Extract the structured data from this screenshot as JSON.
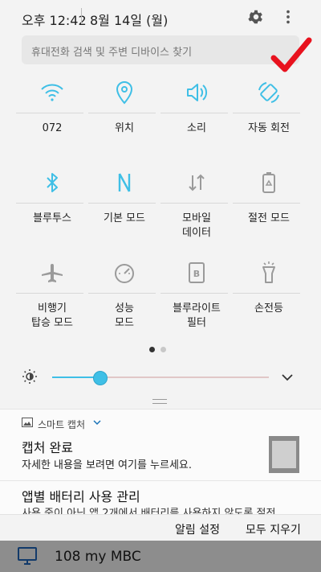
{
  "status_bar": {
    "time": "오후 12:42",
    "date": "8월 14일 (월)",
    "icons": [
      "gear-icon",
      "more-vert-icon"
    ]
  },
  "search": {
    "placeholder": "휴대전화 검색 및 주변 디바이스 찾기",
    "annotation_icon": "red-checkmark-icon"
  },
  "quick_settings": [
    {
      "icon": "wifi-icon",
      "label": "072",
      "label2": "",
      "active": true
    },
    {
      "icon": "location-icon",
      "label": "위치",
      "label2": "",
      "active": true
    },
    {
      "icon": "sound-icon",
      "label": "소리",
      "label2": "",
      "active": true
    },
    {
      "icon": "auto-rotate-icon",
      "label": "자동 회전",
      "label2": "",
      "active": true
    },
    {
      "icon": "bluetooth-icon",
      "label": "블루투스",
      "label2": "",
      "active": true
    },
    {
      "icon": "nfc-icon",
      "label": "기본 모드",
      "label2": "",
      "active": true
    },
    {
      "icon": "mobile-data-icon",
      "label": "모바일",
      "label2": "데이터",
      "active": false
    },
    {
      "icon": "power-saving-icon",
      "label": "절전 모드",
      "label2": "",
      "active": false
    },
    {
      "icon": "airplane-icon",
      "label": "비행기",
      "label2": "탑승 모드",
      "active": false
    },
    {
      "icon": "performance-icon",
      "label": "성능",
      "label2": "모드",
      "active": false
    },
    {
      "icon": "blue-light-filter-icon",
      "label": "블루라이트",
      "label2": "필터",
      "active": false
    },
    {
      "icon": "flashlight-icon",
      "label": "손전등",
      "label2": "",
      "active": false
    }
  ],
  "pager": {
    "current": 1,
    "total": 2
  },
  "brightness": {
    "level": 0.22
  },
  "notifications": {
    "capture": {
      "app_name": "스마트 캡처",
      "title": "캡처 완료",
      "text": "자세한 내용을 보려면 여기를 누르세요."
    },
    "battery": {
      "title": "앱별 배터리 사용 관리",
      "text": "사용 중이 아닌 앱 2개에서 배터리를 사용하지 않도록 절전"
    }
  },
  "actions": {
    "settings_label": "알림 설정",
    "clear_label": "모두 지우기"
  },
  "bottom_item": {
    "label": "108 my MBC"
  },
  "colors": {
    "accent": "#3fbfe6",
    "inactive_icon": "#9a9a9a",
    "annotation": "#e8121e"
  }
}
